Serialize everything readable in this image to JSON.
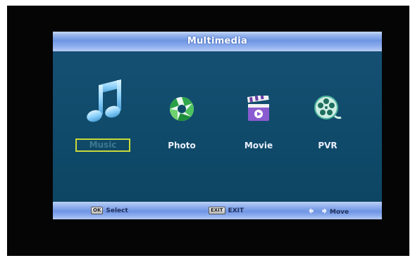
{
  "window": {
    "title": "Multimedia"
  },
  "menu": {
    "items": [
      {
        "label": "Music",
        "icon": "music-note-icon",
        "selected": true
      },
      {
        "label": "Photo",
        "icon": "photo-aperture-icon",
        "selected": false
      },
      {
        "label": "Movie",
        "icon": "clapperboard-icon",
        "selected": false
      },
      {
        "label": "PVR",
        "icon": "film-reel-icon",
        "selected": false
      }
    ]
  },
  "footer": {
    "select_key": "OK",
    "select_label": "Select",
    "exit_key": "EXIT",
    "exit_label": "EXIT",
    "move_label": "Move"
  },
  "colors": {
    "panel_background": "#0f4a68",
    "bar_accent": "#7f9fe8",
    "selection_border": "#c8d93a",
    "screen_background": "#050505"
  }
}
